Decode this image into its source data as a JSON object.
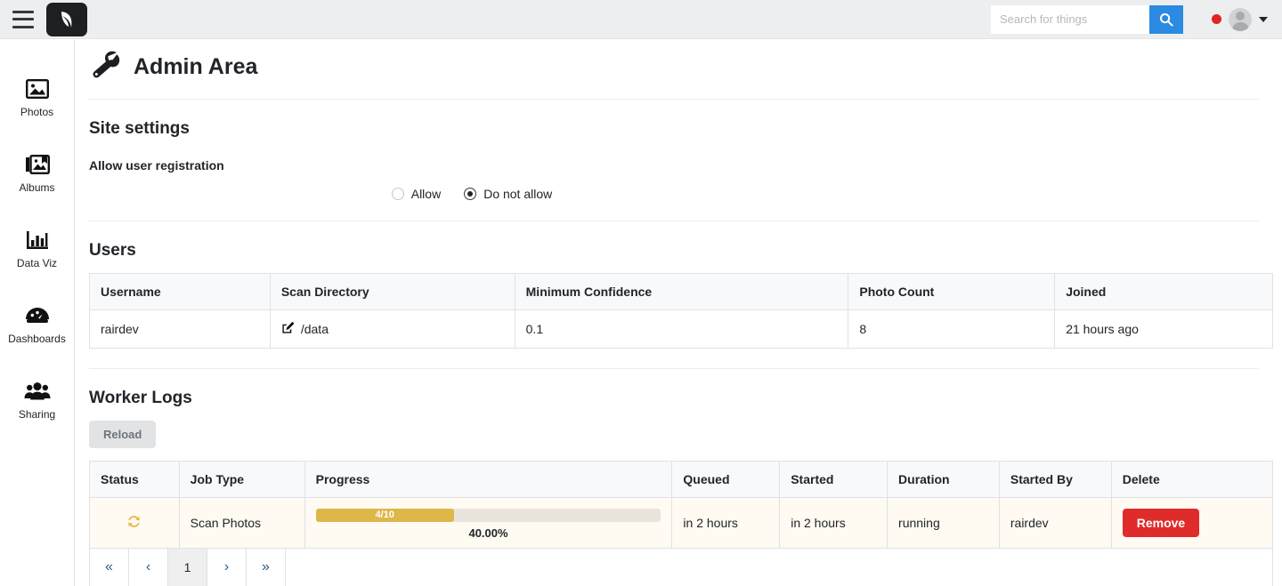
{
  "topbar": {
    "menu_icon": "hamburger-icon",
    "logo_icon": "leaf-logo-icon",
    "search": {
      "placeholder": "Search for things",
      "value": "",
      "button_icon": "search-icon"
    },
    "status_dot_color": "#e02424",
    "avatar_icon": "user-avatar-icon",
    "caret_icon": "chevron-down-icon"
  },
  "sidebar": {
    "items": [
      {
        "label": "Photos",
        "icon": "image-icon"
      },
      {
        "label": "Albums",
        "icon": "albums-icon"
      },
      {
        "label": "Data Viz",
        "icon": "bar-chart-icon"
      },
      {
        "label": "Dashboards",
        "icon": "gauge-icon"
      },
      {
        "label": "Sharing",
        "icon": "people-icon"
      }
    ]
  },
  "page": {
    "title": "Admin Area",
    "title_icon": "wrench-icon"
  },
  "site_settings": {
    "heading": "Site settings",
    "registration_label": "Allow user registration",
    "options": [
      {
        "label": "Allow",
        "selected": false
      },
      {
        "label": "Do not allow",
        "selected": true
      }
    ]
  },
  "users": {
    "heading": "Users",
    "columns": [
      "Username",
      "Scan Directory",
      "Minimum Confidence",
      "Photo Count",
      "Joined"
    ],
    "rows": [
      {
        "username": "rairdev",
        "scan_directory": "/data",
        "scan_directory_icon": "edit-pencil-icon",
        "minimum_confidence": "0.1",
        "photo_count": "8",
        "joined": "21 hours ago"
      }
    ]
  },
  "worker_logs": {
    "heading": "Worker Logs",
    "reload_label": "Reload",
    "columns": [
      "Status",
      "Job Type",
      "Progress",
      "Queued",
      "Started",
      "Duration",
      "Started By",
      "Delete"
    ],
    "rows": [
      {
        "status_icon": "sync-refresh-icon",
        "job_type": "Scan Photos",
        "progress_label": "4/10",
        "progress_percent_label": "40.00%",
        "progress_percent": 40,
        "queued": "in 2 hours",
        "started": "in 2 hours",
        "duration": "running",
        "started_by": "rairdev",
        "delete_label": "Remove"
      }
    ],
    "pagination": {
      "first": "«",
      "prev": "‹",
      "current": "1",
      "next": "›",
      "last": "»"
    }
  },
  "colors": {
    "accent_blue": "#2b8ae2",
    "danger_red": "#e02b2b",
    "progress_amber": "#ddb74a",
    "warn_row": "#fffaf2"
  }
}
